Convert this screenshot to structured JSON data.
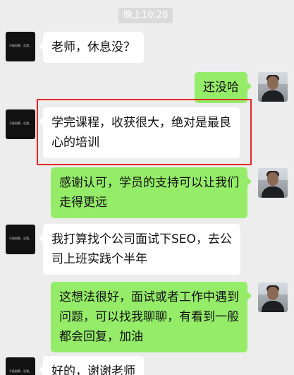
{
  "timestamp": "晚上10:28",
  "contact_avatar_text": "不秘陪葬，没我。",
  "messages": [
    {
      "side": "left",
      "lines": [
        "老师，休息没？"
      ]
    },
    {
      "side": "right",
      "lines": [
        "还没哈"
      ]
    },
    {
      "side": "left",
      "lines": [
        "学完课程，收获很大，绝对是最良",
        "心的培训"
      ]
    },
    {
      "side": "right",
      "lines": [
        "感谢认可，学员的支持可以让我们",
        "走得更远"
      ]
    },
    {
      "side": "left",
      "lines": [
        "我打算找个公司面试下SEO，去公",
        "司上班实践个半年"
      ]
    },
    {
      "side": "right",
      "lines": [
        "这想法很好，面试或者工作中遇到",
        "问题，可以找我聊聊，有看到一般",
        "都会回复，加油"
      ]
    },
    {
      "side": "left",
      "lines": [
        "好的，谢谢老师"
      ]
    }
  ],
  "colors": {
    "background": "#ededed",
    "incoming_bubble": "#ffffff",
    "outgoing_bubble": "#95ec69",
    "highlight": "#e0282a"
  }
}
